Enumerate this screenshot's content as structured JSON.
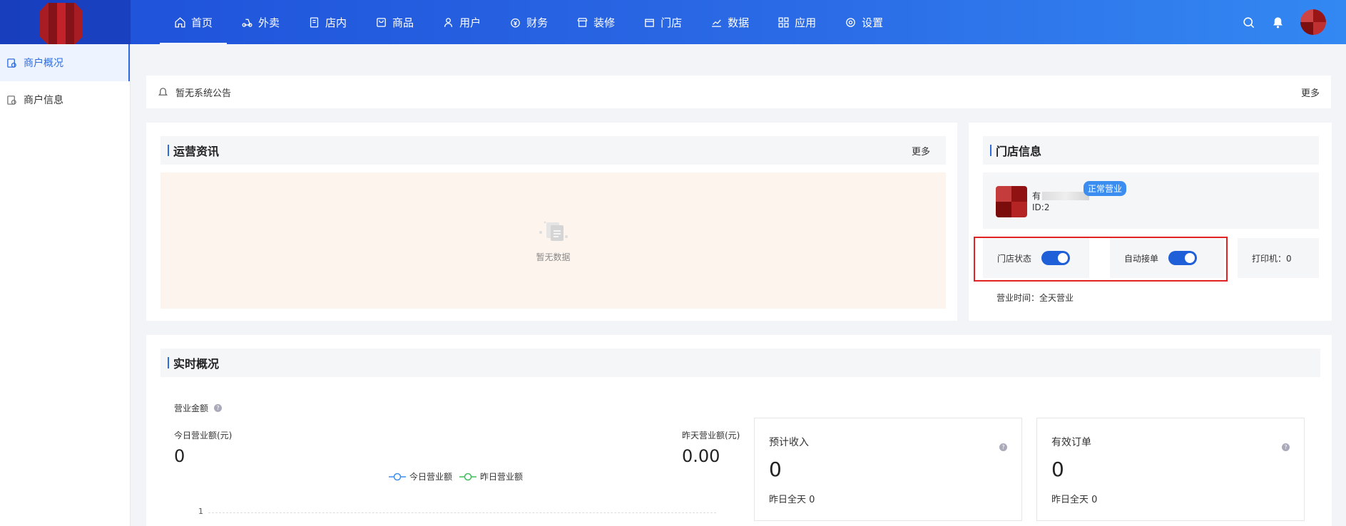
{
  "topnav": {
    "items": [
      {
        "label": "首页",
        "icon": "home-icon",
        "active": true
      },
      {
        "label": "外卖",
        "icon": "delivery-icon"
      },
      {
        "label": "店内",
        "icon": "dine-in-icon"
      },
      {
        "label": "商品",
        "icon": "goods-icon"
      },
      {
        "label": "用户",
        "icon": "user-icon"
      },
      {
        "label": "财务",
        "icon": "finance-icon"
      },
      {
        "label": "装修",
        "icon": "decor-icon"
      },
      {
        "label": "门店",
        "icon": "store-icon"
      },
      {
        "label": "数据",
        "icon": "data-icon"
      },
      {
        "label": "应用",
        "icon": "apps-icon"
      },
      {
        "label": "设置",
        "icon": "gear-icon"
      }
    ]
  },
  "sidebar": {
    "items": [
      {
        "label": "商户概况",
        "active": true
      },
      {
        "label": "商户信息",
        "active": false
      }
    ]
  },
  "notice": {
    "text": "暂无系统公告",
    "more": "更多"
  },
  "operations": {
    "title": "运营资讯",
    "more": "更多",
    "empty_text": "暂无数据"
  },
  "store": {
    "title": "门店信息",
    "name_prefix": "有",
    "id": "ID:2",
    "status_badge": "正常营业",
    "store_status_label": "门店状态",
    "store_status_on": true,
    "auto_accept_label": "自动接单",
    "auto_accept_on": true,
    "printer": "打印机：0",
    "business_hours": "营业时间：全天营业"
  },
  "realtime": {
    "title": "实时概况",
    "revenue_label": "营业金额",
    "today_label": "今日营业额(元)",
    "today_value": "0",
    "yesterday_label": "昨天营业额(元)",
    "yesterday_value": "0.00",
    "legend_today": "今日营业额",
    "legend_yesterday": "昨日营业额",
    "axis_tick": "1",
    "expected_income": {
      "label": "预计收入",
      "value": "0",
      "sub": "昨日全天 0"
    },
    "valid_orders": {
      "label": "有效订单",
      "value": "0",
      "sub": "昨日全天 0"
    }
  },
  "colors": {
    "primary": "#2f6bdc",
    "nav_gradient_start": "#1d4fd8",
    "badge": "#3b8ef0",
    "highlight_frame": "#e32222",
    "legend_today": "#3b8ef0",
    "legend_yesterday": "#3cbf5c"
  }
}
